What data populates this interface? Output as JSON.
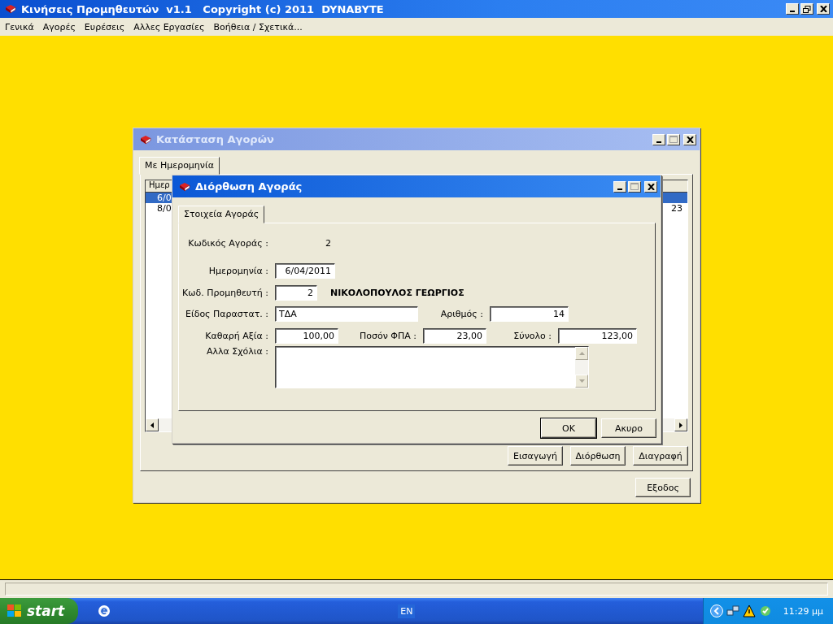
{
  "app": {
    "title": "Κινήσεις Προμηθευτών  v1.1   Copyright (c) 2011  DYNABYTE",
    "menu": [
      "Γενικά",
      "Αγορές",
      "Ευρέσεις",
      "Αλλες Εργασίες",
      "Βοήθεια / Σχετικά..."
    ]
  },
  "status_window": {
    "title": "Κατάσταση Αγορών",
    "active": false,
    "tabs": [
      {
        "label": "Με Ημερομηνία",
        "selected": true
      }
    ],
    "list": {
      "column_1": "Ημερ",
      "rows": [
        {
          "cells": [
            "6/0"
          ],
          "selected": true
        },
        {
          "cells": [
            "8/0",
            "23"
          ],
          "selected": false
        }
      ]
    },
    "buttons": [
      "Εισαγωγή",
      "Διόρθωση",
      "Διαγραφή"
    ],
    "exit_button": "Εξοδος"
  },
  "dialog": {
    "title": "Διόρθωση Αγοράς",
    "active": true,
    "tabs": [
      {
        "label": "Στοιχεία Αγοράς",
        "selected": true
      }
    ],
    "purchase_code": {
      "label": "Κωδικός Αγοράς :",
      "value": "2"
    },
    "date": {
      "label": "Ημερομηνία :",
      "value": "6/04/2011"
    },
    "supplier_code": {
      "label": "Κωδ. Προμηθευτή :",
      "value": "2",
      "name": "ΝΙΚΟΛΟΠΟΥΛΟΣ ΓΕΩΡΓΙΟΣ"
    },
    "document_type": {
      "label": "Είδος Παραστατ. :",
      "value": "ΤΔΑ"
    },
    "number": {
      "label": "Αριθμός :",
      "value": "14"
    },
    "net_value": {
      "label": "Καθαρή Αξία :",
      "value": "100,00"
    },
    "vat": {
      "label": "Ποσόν ΦΠΑ :",
      "value": "23,00"
    },
    "total": {
      "label": "Σύνολο :",
      "value": "123,00"
    },
    "comments": {
      "label": "Αλλα Σχόλια :"
    },
    "buttons": [
      "OK",
      "Ακυρο"
    ]
  },
  "taskbar": {
    "start": "start",
    "language": "EN",
    "clock": "11:29 μμ"
  }
}
